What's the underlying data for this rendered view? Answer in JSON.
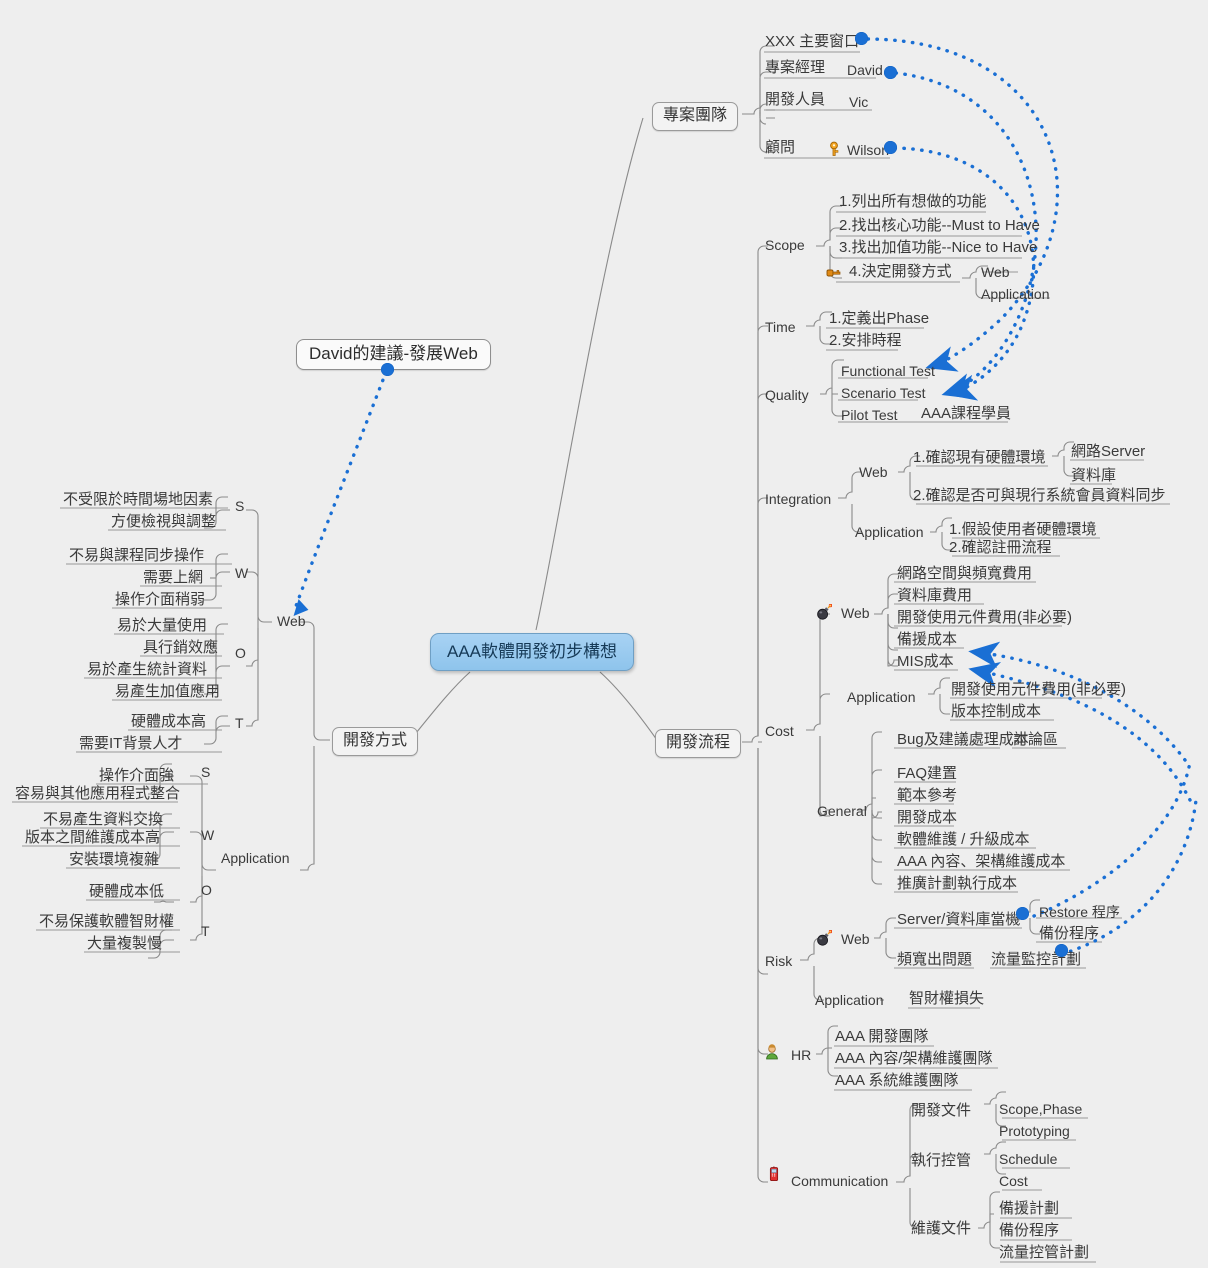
{
  "root": {
    "label": "AAA軟體開發初步構想"
  },
  "callout": {
    "label": "David的建議-發展Web"
  },
  "colors": {
    "root_fill": "#9dcbf0",
    "relation": "#1a6fd4",
    "branch_line": "#8a8a8a",
    "text": "#3a3a3a",
    "background": "#eeeeee"
  },
  "branches": {
    "team": {
      "label": "專案團隊",
      "members": [
        {
          "role": "XXX 主要窗口",
          "name": ""
        },
        {
          "role": "專案經理",
          "name": "David"
        },
        {
          "role": "開發人員",
          "name": "Vic"
        },
        {
          "role": "顧問",
          "name": "Wilson",
          "icon": "key-icon"
        }
      ]
    },
    "method": {
      "label": "開發方式",
      "options": [
        {
          "label": "Web",
          "swot": [
            {
              "key": "S",
              "items": [
                "不受限於時間場地因素",
                "方便檢視與調整"
              ]
            },
            {
              "key": "W",
              "items": [
                "不易與課程同步操作",
                "需要上網",
                "操作介面稍弱"
              ]
            },
            {
              "key": "O",
              "items": [
                "易於大量使用",
                "具行銷效應",
                "易於產生統計資料",
                "易產生加值應用"
              ]
            },
            {
              "key": "T",
              "items": [
                "硬體成本高",
                "需要IT背景人才"
              ]
            }
          ]
        },
        {
          "label": "Application",
          "swot": [
            {
              "key": "S",
              "items": [
                "操作介面強",
                "容易與其他應用程式整合"
              ]
            },
            {
              "key": "W",
              "items": [
                "不易產生資料交換",
                "版本之間維護成本高",
                "安裝環境複雜"
              ]
            },
            {
              "key": "O",
              "items": [
                "硬體成本低"
              ]
            },
            {
              "key": "T",
              "items": [
                "不易保護軟體智財權",
                "大量複製慢"
              ]
            }
          ]
        }
      ]
    },
    "process": {
      "label": "開發流程",
      "sections": [
        {
          "label": "Scope",
          "items": [
            {
              "label": "1.列出所有想做的功能"
            },
            {
              "label": "2.找出核心功能--Must to Have"
            },
            {
              "label": "3.找出加值功能--Nice to Have"
            },
            {
              "label": "4.決定開發方式",
              "icon": "key-pin-icon",
              "children": [
                "Web",
                "Application"
              ]
            }
          ]
        },
        {
          "label": "Time",
          "items": [
            {
              "label": "1.定義出Phase"
            },
            {
              "label": "2.安排時程"
            }
          ]
        },
        {
          "label": "Quality",
          "items": [
            {
              "label": "Functional Test"
            },
            {
              "label": "Scenario Test"
            },
            {
              "label": "Pilot Test",
              "note": "AAA課程學員"
            }
          ]
        },
        {
          "label": "Integration",
          "groups": [
            {
              "label": "Web",
              "items": [
                {
                  "label": "1.確認現有硬體環境",
                  "children": [
                    "網路Server",
                    "資料庫"
                  ]
                },
                {
                  "label": "2.確認是否可與現行系統會員資料同步"
                }
              ]
            },
            {
              "label": "Application",
              "items": [
                {
                  "label": "1.假設使用者硬體環境"
                },
                {
                  "label": "2.確認註冊流程"
                }
              ]
            }
          ]
        },
        {
          "label": "Cost",
          "groups": [
            {
              "label": "Web",
              "icon": "bomb-icon",
              "items": [
                {
                  "label": "網路空間與頻寬費用"
                },
                {
                  "label": "資料庫費用"
                },
                {
                  "label": "開發使用元件費用(非必要)"
                },
                {
                  "label": "備援成本"
                },
                {
                  "label": "MIS成本"
                }
              ]
            },
            {
              "label": "Application",
              "items": [
                {
                  "label": "開發使用元件費用(非必要)"
                },
                {
                  "label": "版本控制成本"
                }
              ]
            },
            {
              "label": "General",
              "items": [
                {
                  "label": "Bug及建議處理成本",
                  "note": "討論區"
                },
                {
                  "label": "FAQ建置"
                },
                {
                  "label": "範本參考"
                },
                {
                  "label": "開發成本"
                },
                {
                  "label": "軟體維護 / 升級成本"
                },
                {
                  "label": "AAA 內容、架構維護成本"
                },
                {
                  "label": "推廣計劃執行成本"
                }
              ]
            }
          ]
        },
        {
          "label": "Risk",
          "groups": [
            {
              "label": "Web",
              "icon": "bomb-icon",
              "items": [
                {
                  "label": "Server/資料庫當機",
                  "children": [
                    "Restore 程序",
                    "備份程序"
                  ]
                },
                {
                  "label": "頻寬出問題",
                  "note": "流量監控計劃"
                }
              ]
            },
            {
              "label": "Application",
              "items": [
                {
                  "label": "智財權損失"
                }
              ]
            }
          ]
        },
        {
          "label": "HR",
          "icon": "person-icon",
          "items": [
            {
              "label": "AAA 開發團隊"
            },
            {
              "label": "AAA 內容/架構維護團隊"
            },
            {
              "label": "AAA 系統維護團隊"
            }
          ]
        },
        {
          "label": "Communication",
          "icon": "mobile-icon",
          "groups": [
            {
              "label": "開發文件",
              "items": [
                {
                  "label": "Scope,Phase"
                },
                {
                  "label": "Prototyping"
                }
              ]
            },
            {
              "label": "執行控管",
              "items": [
                {
                  "label": "Schedule"
                },
                {
                  "label": "Cost"
                }
              ]
            },
            {
              "label": "維護文件",
              "items": [
                {
                  "label": "備援計劃"
                },
                {
                  "label": "備份程序"
                },
                {
                  "label": "流量控管計劃"
                }
              ]
            }
          ]
        }
      ]
    }
  }
}
